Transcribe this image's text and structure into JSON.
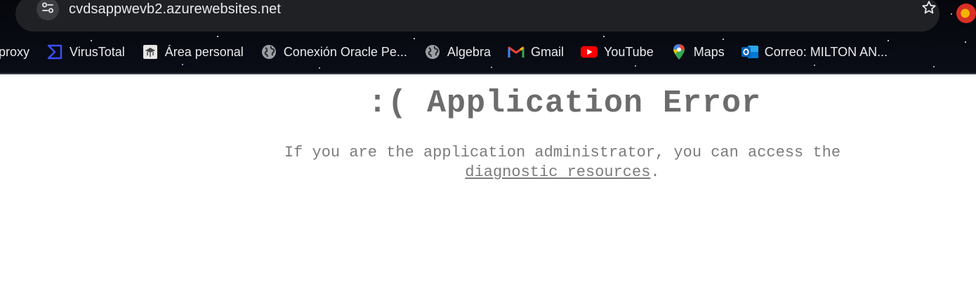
{
  "browser": {
    "address_bar": {
      "url": "cvdsappwevb2.azurewebsites.net"
    },
    "icons": {
      "site_info": "tune-icon",
      "bookmark": "star-outline-icon",
      "profile": "profile-avatar-icon"
    },
    "bookmarks": [
      {
        "label": "proxy",
        "icon": ""
      },
      {
        "label": "VirusTotal",
        "icon": "virustotal-icon"
      },
      {
        "label": "Área personal",
        "icon": "moodle-icon"
      },
      {
        "label": "Conexión Oracle Pe...",
        "icon": "globe-icon"
      },
      {
        "label": "Algebra",
        "icon": "globe-icon"
      },
      {
        "label": "Gmail",
        "icon": "gmail-icon"
      },
      {
        "label": "YouTube",
        "icon": "youtube-icon"
      },
      {
        "label": "Maps",
        "icon": "maps-icon"
      },
      {
        "label": "Correo: MILTON AN...",
        "icon": "outlook-icon"
      }
    ]
  },
  "page": {
    "title": ":( Application Error",
    "message_line1": "If you are the application administrator, you can access the",
    "link_text": "diagnostic resources",
    "period": "."
  },
  "colors": {
    "chrome_bg": "#05070d",
    "omnibox_bg": "#202124",
    "title_color": "#6c6c6c",
    "text_color": "#7c7c7c"
  }
}
